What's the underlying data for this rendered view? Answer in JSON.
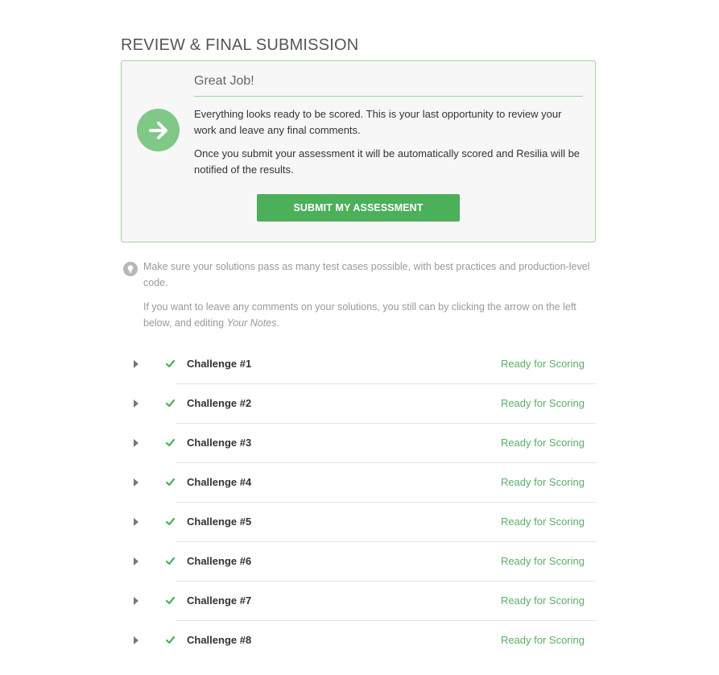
{
  "page": {
    "title": "REVIEW & FINAL SUBMISSION"
  },
  "review_box": {
    "heading": "Great Job!",
    "paragraph_1": "Everything looks ready to be scored. This is your last opportunity to review your work and leave any final comments.",
    "paragraph_2": "Once you submit your assessment it will be automatically scored and Resilia will be notified of the results.",
    "submit_label": "SUBMIT MY ASSESSMENT",
    "icon": "arrow-right-circle-icon"
  },
  "tip": {
    "icon": "lightbulb-icon",
    "line_1": "Make sure your solutions pass as many test cases possible, with best practices and production-level code.",
    "line_2_prefix": "If you want to leave any comments on your solutions, you still can by clicking the arrow on the left below, and editing ",
    "line_2_emphasis": "Your Notes",
    "line_2_suffix": "."
  },
  "challenges": [
    {
      "name": "Challenge #1",
      "status": "Ready for Scoring"
    },
    {
      "name": "Challenge #2",
      "status": "Ready for Scoring"
    },
    {
      "name": "Challenge #3",
      "status": "Ready for Scoring"
    },
    {
      "name": "Challenge #4",
      "status": "Ready for Scoring"
    },
    {
      "name": "Challenge #5",
      "status": "Ready for Scoring"
    },
    {
      "name": "Challenge #6",
      "status": "Ready for Scoring"
    },
    {
      "name": "Challenge #7",
      "status": "Ready for Scoring"
    },
    {
      "name": "Challenge #8",
      "status": "Ready for Scoring"
    }
  ],
  "colors": {
    "accent_green": "#4caf5a",
    "icon_green": "#7fc888",
    "status_green": "#5cae66",
    "box_border": "#9fd49f",
    "box_background": "#f7f7f7",
    "muted_text": "#999999"
  }
}
